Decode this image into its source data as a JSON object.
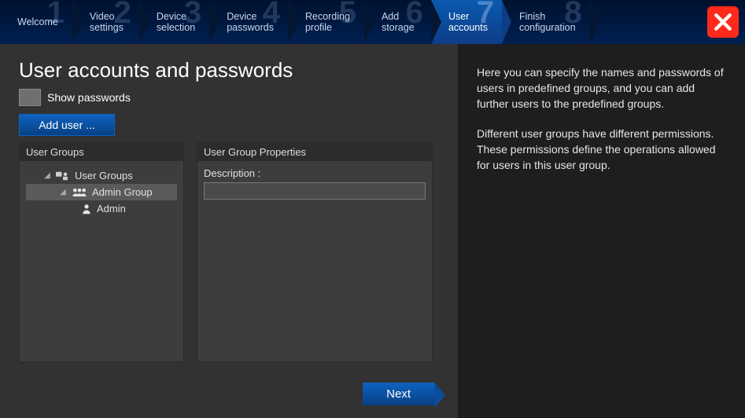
{
  "wizard_steps": [
    {
      "num": "1",
      "label": "Welcome"
    },
    {
      "num": "2",
      "label": "Video\nsettings"
    },
    {
      "num": "3",
      "label": "Device\nselection"
    },
    {
      "num": "4",
      "label": "Device\npasswords"
    },
    {
      "num": "5",
      "label": "Recording\nprofile"
    },
    {
      "num": "6",
      "label": "Add\nstorage"
    },
    {
      "num": "7",
      "label": "User\naccounts"
    },
    {
      "num": "8",
      "label": "Finish\nconfiguration"
    }
  ],
  "active_step_index": 6,
  "page": {
    "title": "User accounts and passwords",
    "show_passwords_label": "Show passwords",
    "add_user_label": "Add user ...",
    "groups_panel_title": "User Groups",
    "props_panel_title": "User Group Properties",
    "description_label": "Description :",
    "description_value": "",
    "next_label": "Next"
  },
  "tree": {
    "root": "User Groups",
    "group": "Admin Group",
    "user": "Admin"
  },
  "help": {
    "p1": "Here you can specify the names and passwords of users in predefined groups, and you can add further users to the predefined groups.",
    "p2": "Different user groups have different permissions. These permissions define the operations allowed for users in this user group."
  }
}
